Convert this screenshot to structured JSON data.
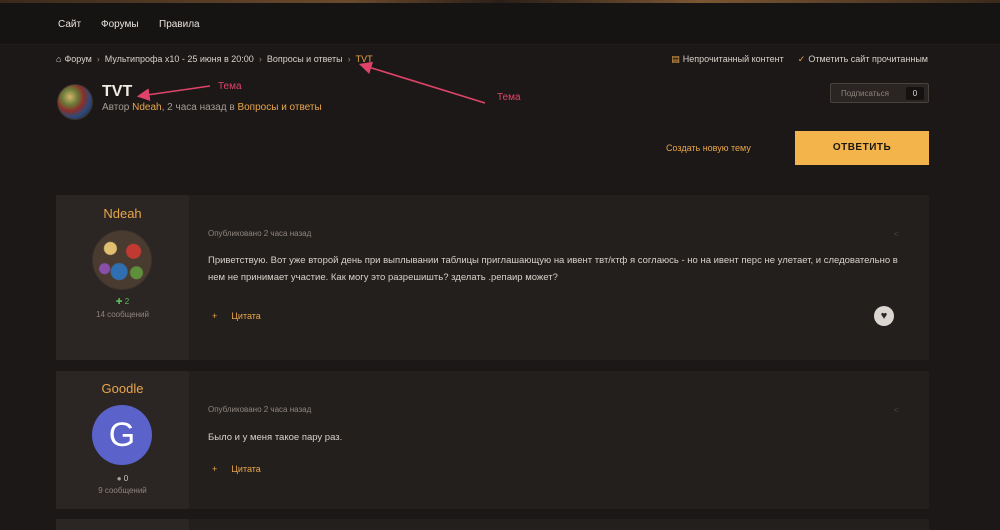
{
  "nav": {
    "items": [
      "Сайт",
      "Форумы",
      "Правила"
    ]
  },
  "breadcrumb": {
    "items": [
      "Форум",
      "Мультипрофа x10 - 25 июня в 20:00",
      "Вопросы и ответы",
      "TVT"
    ]
  },
  "top_links": {
    "unread": "Непрочитанный контент",
    "mark_read": "Отметить сайт прочитанным"
  },
  "topic": {
    "title": "TVT",
    "meta_prefix": "Автор ",
    "author": "Ndeah",
    "meta_time": ", 2 часа назад в ",
    "forum": "Вопросы и ответы",
    "follow_label": "Подписаться",
    "follow_count": "0",
    "new_topic": "Создать новую тему",
    "reply": "ОТВЕТИТЬ"
  },
  "annotations": {
    "label1": "Тема",
    "label2": "Тема",
    "color": "#e0436a"
  },
  "posts": [
    {
      "author": "Ndeah",
      "rep": "2",
      "post_count": "14 сообщений",
      "date": "Опубликовано 2 часа назад",
      "body": "Приветствую. Вот уже второй день при выплывании таблицы приглашающую на ивент твт/ктф я соглаюсь - но на ивент перс не улетает, и следовательно в нем не принимает участие. Как могу это разрешишть? зделать .репаир может?",
      "quote": "Цитата"
    },
    {
      "author": "Goodle",
      "avatar_letter": "G",
      "rep": "0",
      "post_count": "9 сообщений",
      "date": "Опубликовано 2 часа назад",
      "body": "Было и у меня такое пару раз.",
      "quote": "Цитата"
    }
  ],
  "colors": {
    "accent": "#e9a64b",
    "reply_button": "#f3b54b",
    "background": "#1c1817"
  }
}
